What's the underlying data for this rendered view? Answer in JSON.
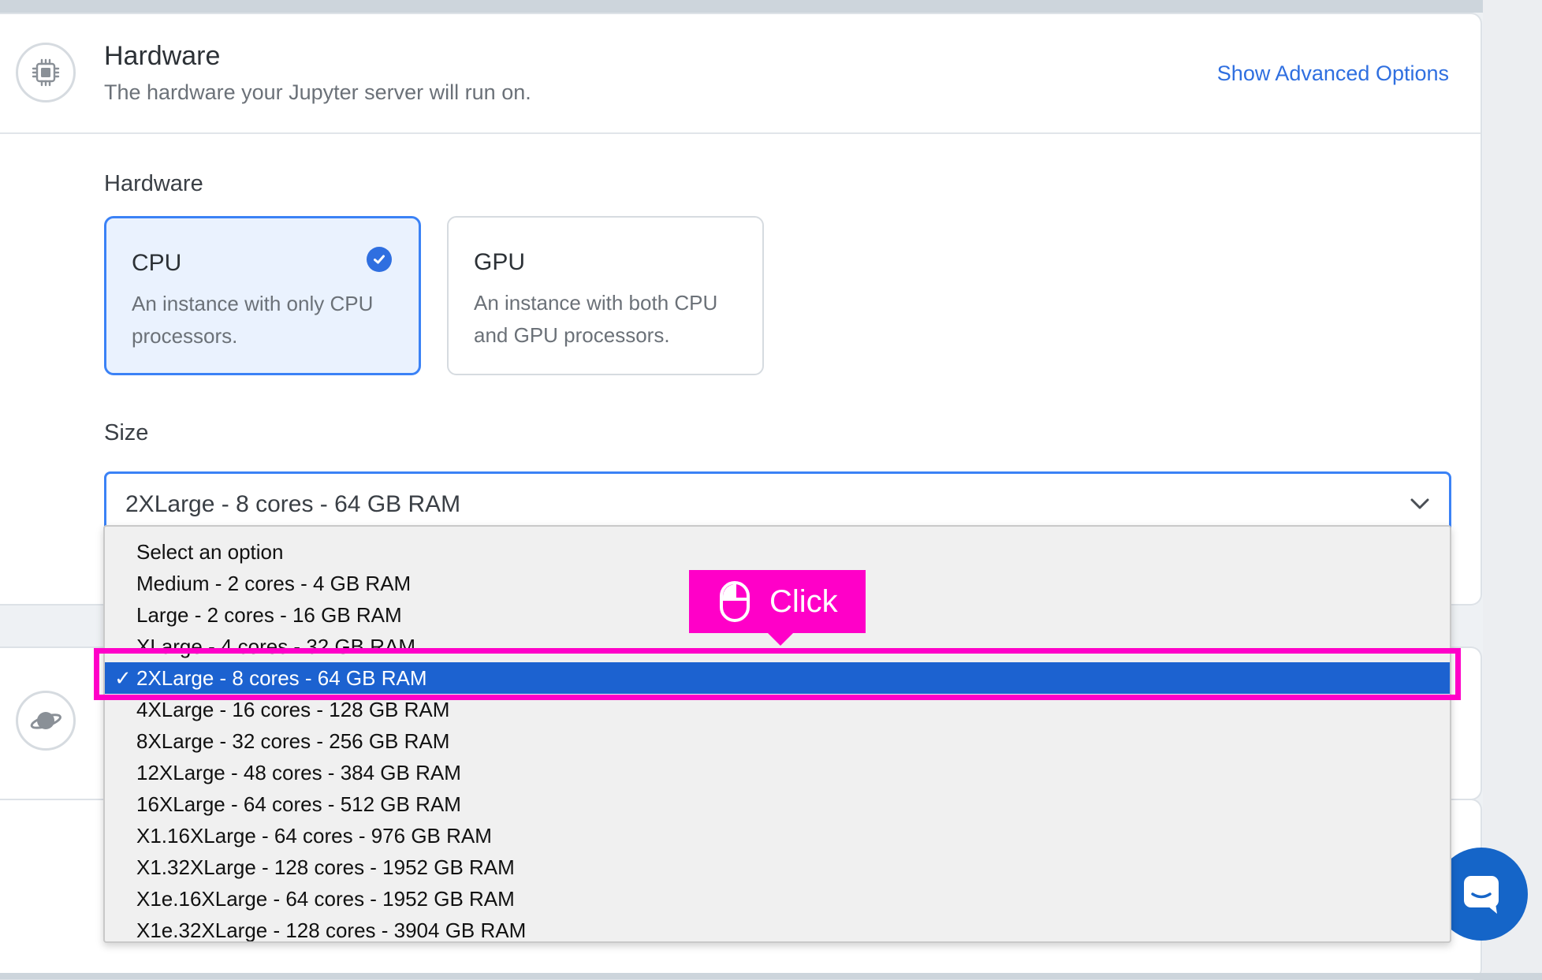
{
  "header": {
    "title": "Hardware",
    "subtitle": "The hardware your Jupyter server will run on.",
    "advanced_link": "Show Advanced Options"
  },
  "hardware_section": {
    "label": "Hardware",
    "options": [
      {
        "title": "CPU",
        "description": "An instance with only CPU processors.",
        "selected": true
      },
      {
        "title": "GPU",
        "description": "An instance with both CPU and GPU processors.",
        "selected": false
      }
    ]
  },
  "size_section": {
    "label": "Size",
    "selected_value": "2XLarge - 8 cores - 64 GB RAM",
    "options": [
      "Select an option",
      "Medium - 2 cores - 4 GB RAM",
      "Large - 2 cores - 16 GB RAM",
      "XLarge - 4 cores - 32 GB RAM",
      "2XLarge - 8 cores - 64 GB RAM",
      "4XLarge - 16 cores - 128 GB RAM",
      "8XLarge - 32 cores - 256 GB RAM",
      "12XLarge - 48 cores - 384 GB RAM",
      "16XLarge - 64 cores - 512 GB RAM",
      "X1.16XLarge - 64 cores - 976 GB RAM",
      "X1.32XLarge - 128 cores - 1952 GB RAM",
      "X1e.16XLarge - 64 cores - 1952 GB RAM",
      "X1e.32XLarge - 128 cores - 3904 GB RAM"
    ],
    "selected_index": 4,
    "check_mark": "✓"
  },
  "annotation": {
    "label": "Click"
  },
  "icons": {
    "hardware": "chip-icon",
    "environment": "planet-icon",
    "chat": "chat-icon",
    "dropdown": "chevron-down-icon",
    "selected": "checkmark-icon",
    "mouse": "mouse-icon"
  },
  "colors": {
    "accent": "#2f6fe0",
    "selected_bg": "#eaf2fe",
    "dropdown_highlight": "#1c62d0",
    "annotation": "#ff00c8",
    "chat": "#1565c8"
  }
}
